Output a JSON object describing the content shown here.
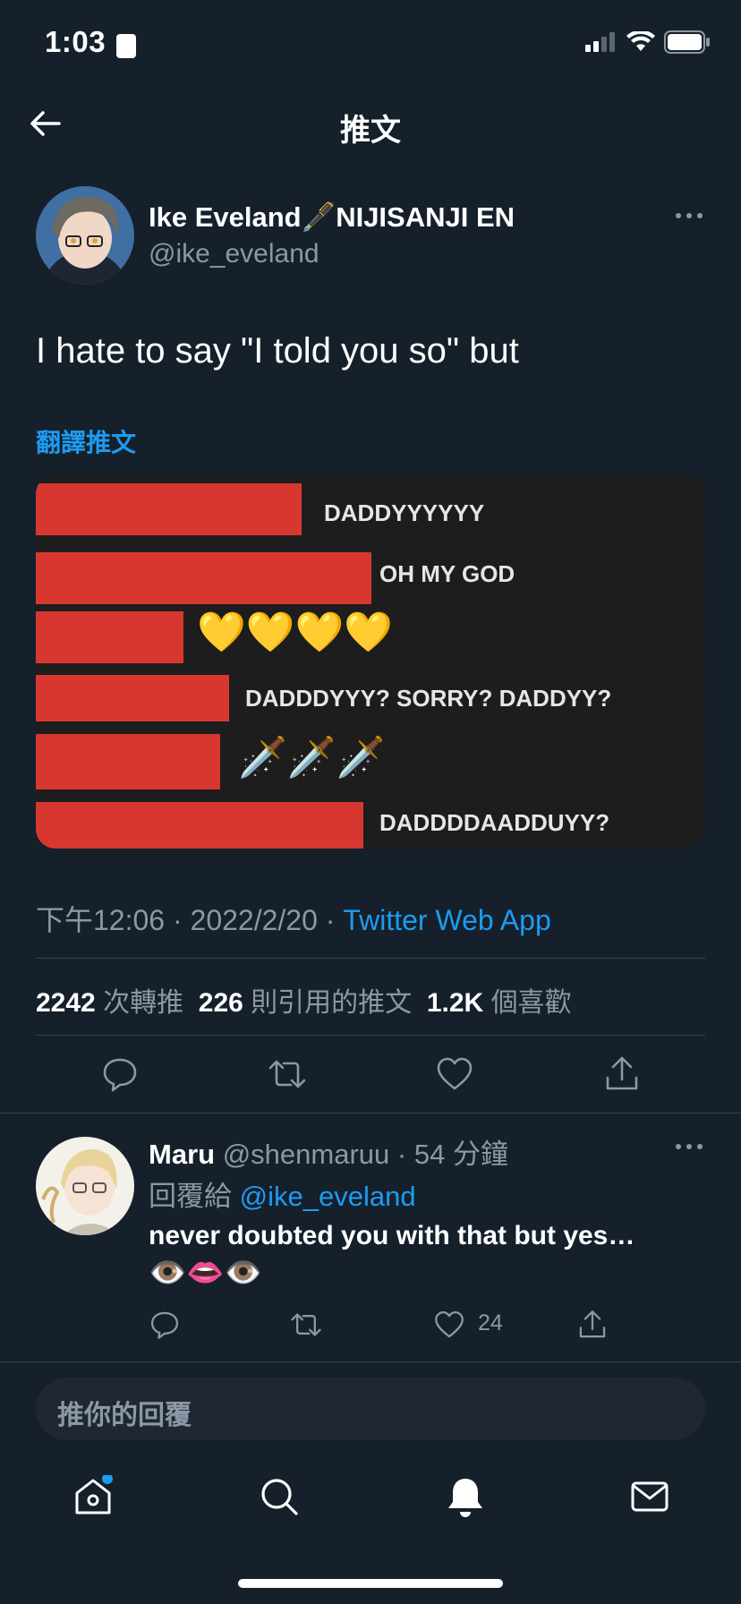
{
  "status_bar": {
    "time": "1:03"
  },
  "nav": {
    "title": "推文"
  },
  "tweet": {
    "author_name": "Ike Eveland🖋️NIJISANJI EN",
    "author_handle": "@ike_eveland",
    "text": "I hate to say \"I told you so\" but",
    "translate_label": "翻譯推文",
    "media_lines": [
      "DADDYYYYYY",
      "OH MY GOD",
      "💛💛💛💛",
      "DADDDYYY? SORRY? DADDYY?",
      "🗡️🗡️🗡️",
      "DADDDDAADDUYY?"
    ],
    "time": "下午12:06",
    "date": "2022/2/20",
    "separator": "·",
    "source": "Twitter Web App",
    "retweets_count": "2242",
    "retweets_label": "次轉推",
    "quotes_count": "226",
    "quotes_label": "則引用的推文",
    "likes_count": "1.2K",
    "likes_label": "個喜歡"
  },
  "reply": {
    "author_name": "Maru",
    "author_handle": "@shenmaruu",
    "separator": "·",
    "time_ago": "54 分鐘",
    "replying_to_label": "回覆給",
    "replying_to_handle": "@ike_eveland",
    "text": "never doubted you with that but yes…",
    "emoji": "👁️👄👁️",
    "like_count": "24"
  },
  "composer": {
    "placeholder": "推你的回覆"
  },
  "tabs": [
    "home-icon",
    "search-icon",
    "notifications-icon",
    "messages-icon"
  ],
  "colors": {
    "background": "#15202b",
    "accent": "#1d9bf0",
    "muted": "#8b98a5",
    "redaction": "#d8372f"
  }
}
